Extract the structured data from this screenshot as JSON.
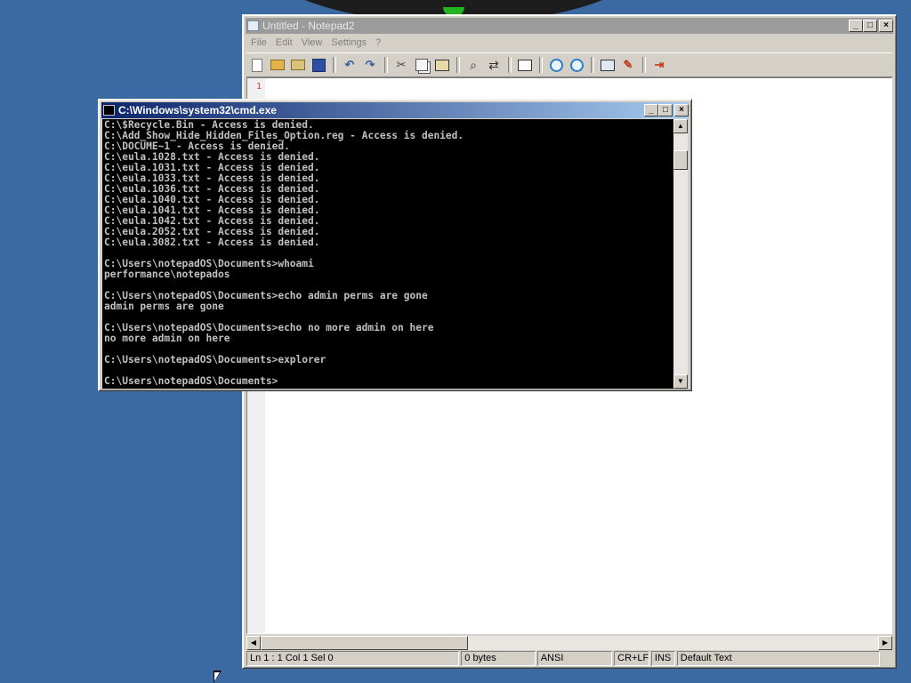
{
  "notepad": {
    "title": "Untitled - Notepad2",
    "menu": [
      "File",
      "Edit",
      "View",
      "Settings",
      "?"
    ],
    "line_number": "1",
    "status": {
      "position": "Ln 1 : 1  Col 1  Sel 0",
      "size": "0 bytes",
      "encoding": "ANSI",
      "eol": "CR+LF",
      "mode": "INS",
      "scheme": "Default Text"
    }
  },
  "cmd": {
    "title": "C:\\Windows\\system32\\cmd.exe",
    "lines": [
      "C:\\$Recycle.Bin - Access is denied.",
      "C:\\Add_Show_Hide_Hidden_Files_Option.reg - Access is denied.",
      "C:\\DOCUME~1 - Access is denied.",
      "C:\\eula.1028.txt - Access is denied.",
      "C:\\eula.1031.txt - Access is denied.",
      "C:\\eula.1033.txt - Access is denied.",
      "C:\\eula.1036.txt - Access is denied.",
      "C:\\eula.1040.txt - Access is denied.",
      "C:\\eula.1041.txt - Access is denied.",
      "C:\\eula.1042.txt - Access is denied.",
      "C:\\eula.2052.txt - Access is denied.",
      "C:\\eula.3082.txt - Access is denied.",
      "",
      "C:\\Users\\notepadOS\\Documents>whoami",
      "performance\\notepados",
      "",
      "C:\\Users\\notepadOS\\Documents>echo admin perms are gone",
      "admin perms are gone",
      "",
      "C:\\Users\\notepadOS\\Documents>echo no more admin on here",
      "no more admin on here",
      "",
      "C:\\Users\\notepadOS\\Documents>explorer",
      "",
      "C:\\Users\\notepadOS\\Documents>"
    ]
  },
  "icons": {
    "toolbar": [
      "new-file-icon",
      "open-folder-icon",
      "browse-icon",
      "save-icon",
      "undo-icon",
      "redo-icon",
      "cut-icon",
      "copy-icon",
      "paste-icon",
      "find-icon",
      "replace-icon",
      "goto-icon",
      "zoom-in-icon",
      "zoom-out-icon",
      "scheme-icon",
      "customize-icon",
      "exit-icon"
    ]
  },
  "colors": {
    "desktop": "#3b6aa2",
    "cmd_title_active": "#0a246a",
    "notepad_title_inactive": "#9b9b9b"
  }
}
